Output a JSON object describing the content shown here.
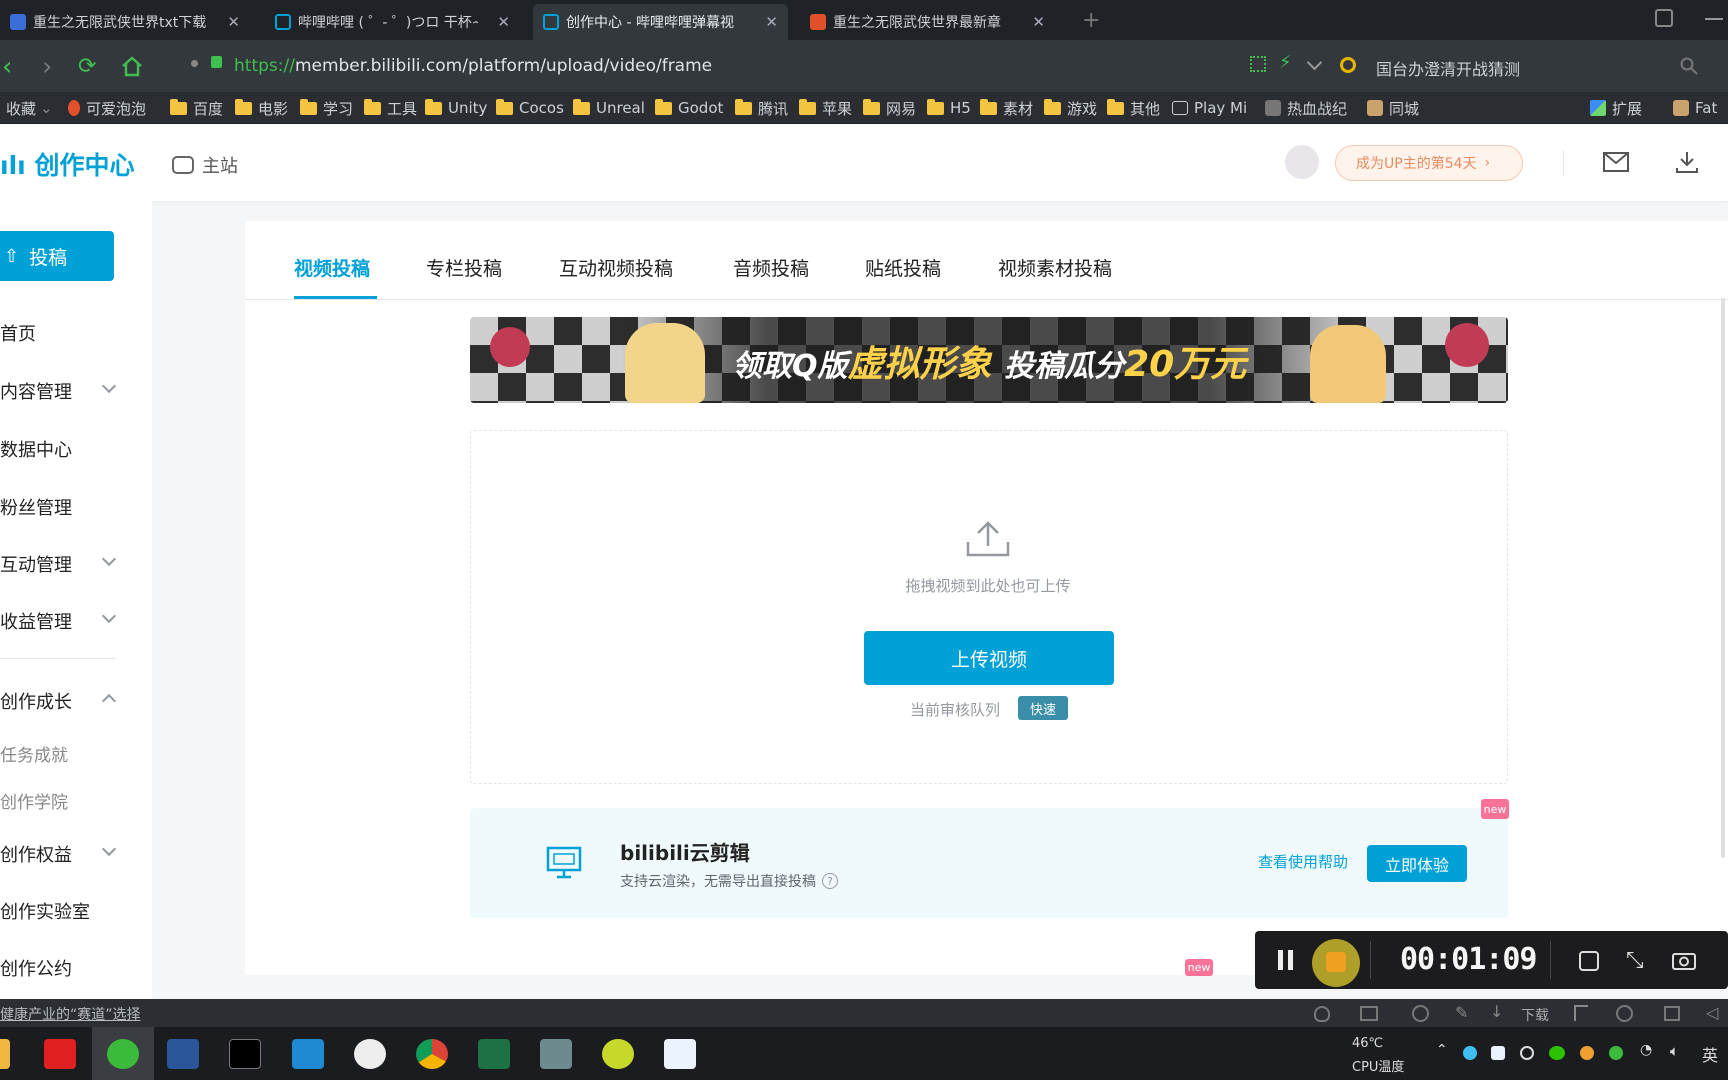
{
  "browser": {
    "tabs": [
      {
        "title": "重生之无限武侠世界txt下载",
        "color": "#3a6fd8"
      },
      {
        "title": "哔哩哔哩 ( ゜- ゜)つロ 干杯~",
        "color": "#00a1d6"
      },
      {
        "title": "创作中心 - 哔哩哔哩弹幕视",
        "color": "#00a1d6"
      },
      {
        "title": "重生之无限武侠世界最新章",
        "color": "#e0502a"
      }
    ],
    "url_scheme": "https://",
    "url_rest": "member.bilibili.com/platform/upload/video/frame",
    "search_text": "国台办澄清开战猜测",
    "bookmarks": [
      "收藏",
      "可爱泡泡",
      "百度",
      "电影",
      "学习",
      "工具",
      "Unity",
      "Cocos",
      "Unreal",
      "Godot",
      "腾讯",
      "苹果",
      "网易",
      "H5",
      "素材",
      "游戏",
      "其他",
      "Play Mi",
      "热血战纪",
      "同城",
      "扩展",
      "Fat"
    ]
  },
  "header": {
    "logo_prefix": "ılı",
    "logo_text": "创作中心",
    "main_site": "主站",
    "up_days": "成为UP主的第54天"
  },
  "sidebar": {
    "upload_button": "投稿",
    "items": [
      "首页",
      "内容管理",
      "数据中心",
      "粉丝管理",
      "互动管理",
      "收益管理",
      "创作成长",
      "任务成就",
      "创作学院",
      "创作权益",
      "创作实验室",
      "创作公约"
    ]
  },
  "content": {
    "tabs": [
      "视频投稿",
      "专栏投稿",
      "互动视频投稿",
      "音频投稿",
      "贴纸投稿",
      "视频素材投稿"
    ],
    "banner_text_a": "领取Q版",
    "banner_text_b": "虚拟形象",
    "banner_text_c": "投稿瓜分",
    "banner_text_d": "20万元",
    "drop_hint": "拖拽视频到此处也可上传",
    "upload_button": "上传视频",
    "queue_label": "当前审核队列",
    "queue_badge": "快速",
    "cloud_title": "bilibili云剪辑",
    "cloud_desc": "支持云渲染，无需导出直接投稿",
    "cloud_help": "查看使用帮助",
    "cloud_try": "立即体验",
    "new_badge": "new"
  },
  "recorder": {
    "time": "00:01:09"
  },
  "statusbar": {
    "left_text": "健康产业的“赛道”选择",
    "download": "下载"
  },
  "taskbar": {
    "temperature": "46℃",
    "cpu": "CPU温度",
    "ime": "英"
  },
  "colors": {
    "accent": "#00a1d6",
    "pink": "#fb7299"
  }
}
